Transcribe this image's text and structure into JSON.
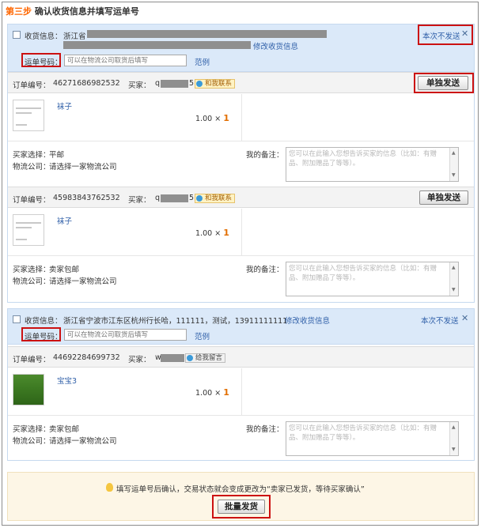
{
  "header": {
    "step": "第三步",
    "title": "确认收货信息并填写运单号"
  },
  "group1": {
    "address_label": "收货信息：",
    "address_visible": "浙江省",
    "modify_link": "修改收货信息",
    "skip_link": "本次不发送",
    "waybill_label": "运单号码：",
    "waybill_placeholder": "可以在物流公司取货后填写",
    "example_link": "范例",
    "orders": [
      {
        "order_label": "订单编号：",
        "order_no": "46271686982532",
        "buyer_label": "买家：",
        "buyer_prefix": "q",
        "buyer_suffix": "5",
        "chat_label": "和我联系",
        "send_button": "单独发送",
        "product_name": "袜子",
        "qty_price": "1.00",
        "qty_x": "×",
        "qty_count": "1",
        "buyer_choice_label": "买家选择：",
        "buyer_choice": "平邮",
        "logistics_label": "物流公司：",
        "logistics": "请选择一家物流公司",
        "remark_label": "我的备注：",
        "remark_placeholder": "您可以在此输入您想告诉买家的信息（比如：有赠品、附加赠品了等等）。"
      },
      {
        "order_label": "订单编号：",
        "order_no": "45983843762532",
        "buyer_label": "买家：",
        "buyer_prefix": "q",
        "buyer_suffix": "5",
        "chat_label": "和我联系",
        "send_button": "单独发送",
        "product_name": "袜子",
        "qty_price": "1.00",
        "qty_x": "×",
        "qty_count": "1",
        "buyer_choice_label": "买家选择：",
        "buyer_choice": "卖家包邮",
        "logistics_label": "物流公司：",
        "logistics": "请选择一家物流公司",
        "remark_label": "我的备注：",
        "remark_placeholder": "您可以在此输入您想告诉买家的信息（比如：有赠品、附加赠品了等等）。"
      }
    ]
  },
  "group2": {
    "address_label": "收货信息：",
    "address": "浙江省宁波市江东区杭州行长哈，111111，测试，13911111111",
    "modify_link": "修改收货信息",
    "skip_link": "本次不发送",
    "waybill_label": "运单号码：",
    "waybill_placeholder": "可以在物流公司取货后填写",
    "example_link": "范例",
    "order": {
      "order_label": "订单编号：",
      "order_no": "44692284699732",
      "buyer_label": "买家：",
      "buyer_prefix": "w",
      "chat_label": "给我留言",
      "product_name": "宝宝3",
      "qty_price": "1.00",
      "qty_x": "×",
      "qty_count": "1",
      "buyer_choice_label": "买家选择：",
      "buyer_choice": "卖家包邮",
      "logistics_label": "物流公司：",
      "logistics": "请选择一家物流公司",
      "remark_label": "我的备注：",
      "remark_placeholder": "您可以在此输入您想告诉买家的信息（比如：有赠品、附加赠品了等等）。"
    }
  },
  "footer": {
    "tip": "填写运单号后确认，交易状态就会变成更改为“卖家已发货，等待买家确认”",
    "batch_button": "批量发货"
  },
  "colors": {
    "step": "#ff6600",
    "highlight": "#cc1111",
    "header_bg": "#dbe9f9",
    "qty": "#e26e00"
  }
}
